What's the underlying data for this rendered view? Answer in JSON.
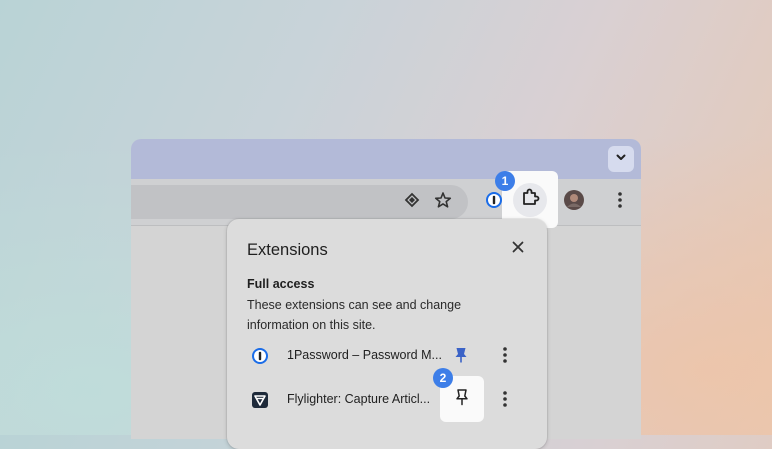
{
  "toolbar": {
    "icons": [
      "reader-mode-icon",
      "bookmark-star-icon",
      "onepassword-icon",
      "extensions-puzzle-icon",
      "profile-avatar",
      "more-vertical-icon"
    ],
    "tab_menu_icon": "chevron-down-icon"
  },
  "badges": {
    "first": "1",
    "second": "2"
  },
  "extensions_popup": {
    "title": "Extensions",
    "close_icon": "close-icon",
    "section_title": "Full access",
    "section_description": "These extensions can see and change information on this site.",
    "items": [
      {
        "name": "1Password – Password M...",
        "icon": "onepassword-icon",
        "pinned": true
      },
      {
        "name": "Flylighter: Capture Articl...",
        "icon": "flylighter-icon",
        "pinned": false
      }
    ]
  },
  "colors": {
    "badge": "#3d7ee8",
    "pin_active": "#3b63c7",
    "tabstrip": "#b3bad8"
  }
}
